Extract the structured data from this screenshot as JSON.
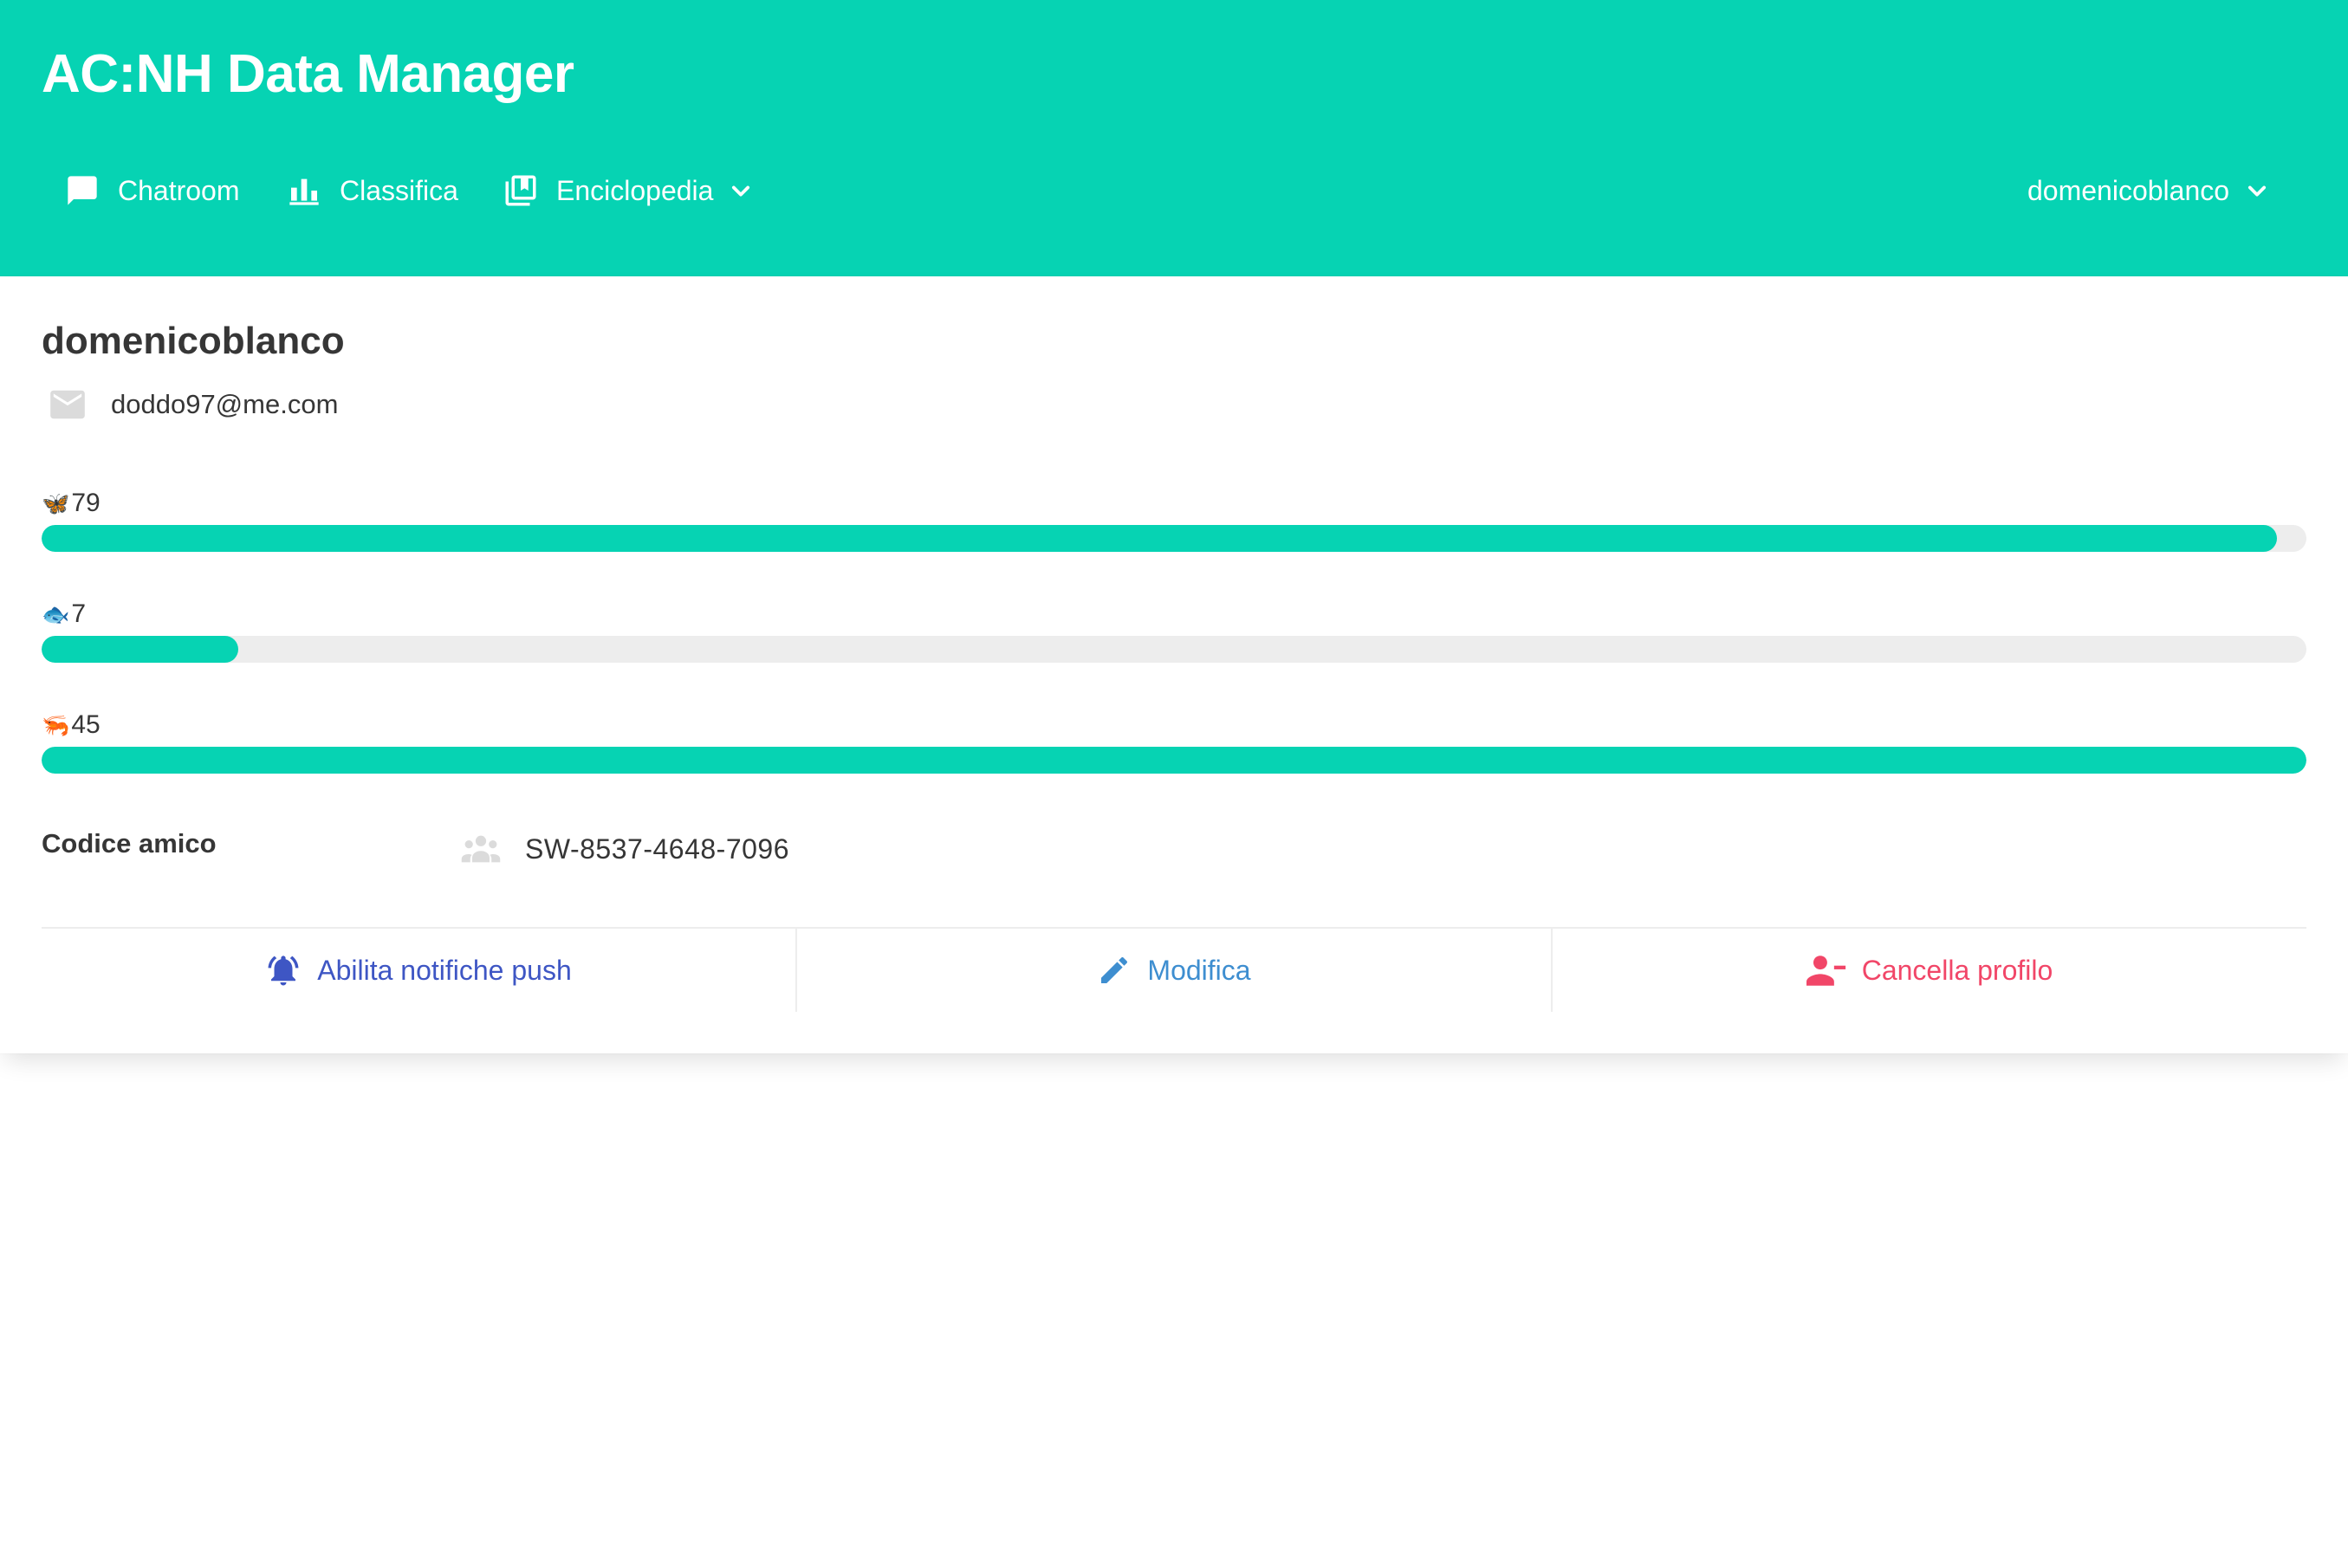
{
  "header": {
    "title": "AC:NH Data Manager",
    "nav": {
      "chatroom": "Chatroom",
      "classifica": "Classifica",
      "enciclopedia": "Enciclopedia"
    },
    "user_menu": "domenicoblanco"
  },
  "profile": {
    "username": "domenicoblanco",
    "email": "doddo97@me.com",
    "stats": [
      {
        "icon": "butterfly-emoji",
        "emoji": "🦋",
        "value": "79",
        "progress": 0.987
      },
      {
        "icon": "fish-emoji",
        "emoji": "🐟",
        "value": "7",
        "progress": 0.087
      },
      {
        "icon": "shrimp-emoji",
        "emoji": "🦐",
        "value": "45",
        "progress": 1.0
      }
    ],
    "friend_code_label": "Codice amico",
    "friend_code": "SW-8537-4648-7096"
  },
  "actions": {
    "push": "Abilita notifiche push",
    "edit": "Modifica",
    "delete": "Cancella profilo"
  },
  "colors": {
    "primary": "#06d3b3",
    "track": "#ededed",
    "push": "#3e56c4",
    "edit": "#3e8ed0",
    "delete": "#f14668"
  }
}
